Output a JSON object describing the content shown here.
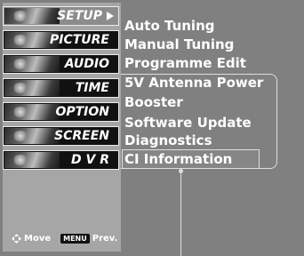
{
  "left_menu": {
    "items": [
      {
        "label": "SETUP",
        "selected": true,
        "icon": "setup-thumbnail-icon"
      },
      {
        "label": "PICTURE",
        "selected": false,
        "icon": "picture-thumbnail-icon"
      },
      {
        "label": "AUDIO",
        "selected": false,
        "icon": "audio-thumbnail-icon"
      },
      {
        "label": "TIME",
        "selected": false,
        "icon": "time-thumbnail-icon"
      },
      {
        "label": "OPTION",
        "selected": false,
        "icon": "option-thumbnail-icon"
      },
      {
        "label": "SCREEN",
        "selected": false,
        "icon": "screen-thumbnail-icon"
      },
      {
        "label": "D V R",
        "selected": false,
        "icon": "dvr-thumbnail-icon"
      }
    ]
  },
  "footer": {
    "move_label": "Move",
    "menu_key": "MENU",
    "prev_label": "Prev."
  },
  "submenu": {
    "items": [
      "Auto Tuning",
      "Manual Tuning",
      "Programme Edit",
      "5V Antenna Power",
      "Booster",
      "Software Update",
      "Diagnostics",
      "CI Information"
    ],
    "highlighted": "CI Information"
  },
  "colors": {
    "background": "#808080",
    "menu_panel": "#a6a6a6",
    "selected_item": "#8c8c8c",
    "text": "#ffffff"
  }
}
